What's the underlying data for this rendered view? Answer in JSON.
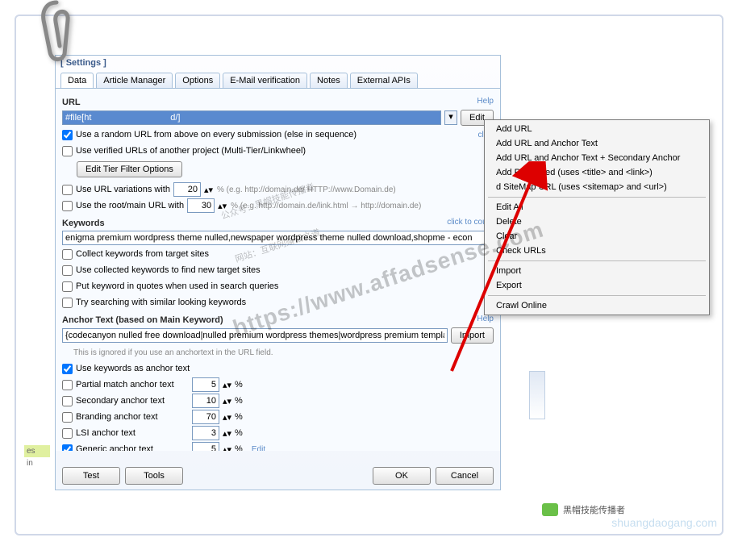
{
  "window": {
    "title": "[ Settings ]"
  },
  "tabs": {
    "data": "Data",
    "article": "Article Manager",
    "options": "Options",
    "email": "E-Mail verification",
    "notes": "Notes",
    "apis": "External APIs"
  },
  "url": {
    "label": "URL",
    "help": "Help",
    "value": "#file[ht                                d/]",
    "edit": "Edit",
    "random": "Use a random URL from above on every submission (else in sequence)",
    "click": "click",
    "verified": "Use verified URLs of another project (Multi-Tier/Linkwheel)",
    "tier_btn": "Edit Tier Filter Options",
    "variations": "Use URL variations with",
    "variations_val": "20",
    "variations_eg": "% (e.g. http://domain.de/ HTTP://www.Domain.de)",
    "root": "Use the root/main URL with",
    "root_val": "30",
    "root_eg": "% (e.g. http://domain.de/link.html → http://domain.de)"
  },
  "keywords": {
    "label": "Keywords",
    "value": "enigma premium wordpress theme nulled,newspaper wordpress theme nulled download,shopme - econ",
    "collect": "Collect keywords from target sites",
    "use_collected": "Use collected keywords to find new target sites",
    "quotes": "Put keyword in quotes when used in search queries",
    "similar": "Try searching with similar looking keywords",
    "click_count": "click to count"
  },
  "anchor": {
    "label": "Anchor Text (based on Main Keyword)",
    "help": "Help",
    "value": "{codecanyon nulled free download|nulled premium wordpress themes|wordpress premium templates n",
    "import": "Import",
    "note": "This is ignored if you use an anchortext in the URL field.",
    "use_kw": "Use keywords as anchor text",
    "partial": "Partial match anchor text",
    "partial_val": "5",
    "secondary": "Secondary anchor text",
    "secondary_val": "10",
    "branding": "Branding anchor text",
    "branding_val": "70",
    "lsi": "LSI anchor text",
    "lsi_val": "3",
    "generic": "Generic anchor text",
    "generic_val": "5",
    "pct": "%",
    "edit": "Edit"
  },
  "buttons": {
    "test": "Test",
    "tools": "Tools",
    "ok": "OK",
    "cancel": "Cancel"
  },
  "context": {
    "add_url": "Add URL",
    "add_url_anchor": "Add URL and Anchor Text",
    "add_url_anchor2": "Add URL and Anchor Text + Secondary Anchor",
    "add_rss": "Add RSS Feed (uses <title> and <link>)",
    "add_sitemap": "d SiteMap URL (uses <sitemap> and <url>)",
    "edit_all": "Edit All",
    "delete": "Delete",
    "clear": "Clear",
    "check": "Check URLs",
    "import": "Import",
    "export": "Export",
    "crawl": "Crawl Online"
  },
  "watermark": {
    "cn1": "公众号：黑帽技能传播者",
    "cn2": "网站：互联网赚钱之道",
    "url": "https://www.affadsense.com"
  },
  "chat": "黑帽技能传播者",
  "corner": "shuangdaogang.com",
  "strip": {
    "es": "es",
    "in": "in"
  }
}
